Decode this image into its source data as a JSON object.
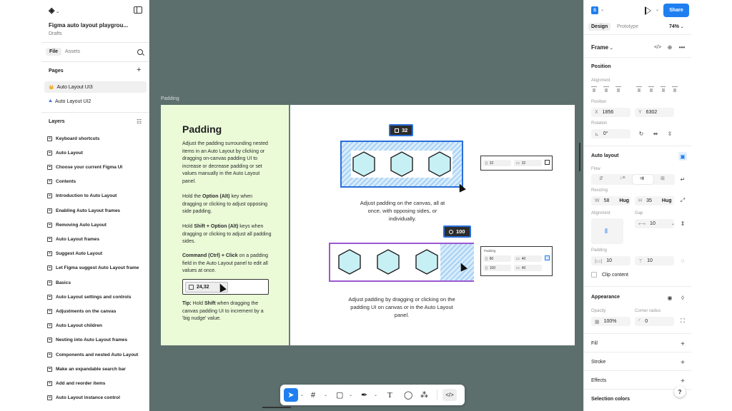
{
  "app": {
    "file_title": "Figma auto layout playgrou...",
    "file_location": "Drafts"
  },
  "left_panel": {
    "tabs": [
      "File",
      "Assets"
    ],
    "pages_title": "Pages",
    "pages": [
      {
        "label": "Auto Layout UI3",
        "icon": "👑"
      },
      {
        "label": "Auto Layout UI2",
        "icon": "⛰"
      }
    ],
    "layers_title": "Layers",
    "layers": [
      "Keyboard shortcuts",
      "Auto Layout",
      "Choose your current Figma UI",
      "Contents",
      "Introduction to Auto Layout",
      "Enabling Auto Layout frames",
      "Removing Auto Layout",
      "Auto Layout frames",
      "Suggest Auto Layout",
      "Let Figma suggest Auto Layout frame",
      "Basics",
      "Auto Layout settings and controls",
      "Adjustments on the canvas",
      "Auto Layout children",
      "Nesting into Auto Layout frames",
      "Components and nested Auto Layout",
      "Make an expandable search bar",
      "Add and  reorder items",
      "Auto Layout instance control"
    ]
  },
  "canvas": {
    "frame_label": "Padding",
    "green": {
      "title": "Padding",
      "p1": "Adjust the padding surrounding nested items in an Auto Layout by clicking or dragging on-canvas padding UI to increase or decrease padding or set values manually in the Auto Layout panel.",
      "p2a": "Hold the ",
      "p2b": "Option (Alt)",
      "p2c": " key when dragging or clicking to adjust opposing side padding.",
      "p3a": "Hold ",
      "p3b": "Shift + Option (Alt)",
      "p3c": " keys when dragging or clicking to adjust all padding sides.",
      "p4a": "Command (Ctrl) + Click",
      "p4b": " on a padding field in the Auto Layout panel to edit all values at once.",
      "input_value": "24,32",
      "tip_a": "Tip:",
      "tip_b": " Hold ",
      "tip_c": "Shift",
      "tip_d": " when dragging the canvas padding UI to increment by a 'big nudge' value."
    },
    "demo1": {
      "pill": "32",
      "caption": "Adjust padding on the canvas, all at once, with opposing sides, or individually.",
      "field_a": "32",
      "field_b": "32"
    },
    "demo2": {
      "pill": "100",
      "caption": "Adjust padding by dragging or clicking on the padding UI on canvas or in the Auto Layout panel.",
      "panel_title": "Padding",
      "f1": "80",
      "f2": "40",
      "f3": "100",
      "f4": "40"
    },
    "toolbar_icons": [
      "move-tool",
      "frame-tool",
      "shape-tool",
      "pen-tool",
      "text-tool",
      "comment-tool",
      "actions-tool",
      "dev-mode-toggle"
    ]
  },
  "right_panel": {
    "avatar": "S",
    "share": "Share",
    "tabs": [
      "Design",
      "Prototype"
    ],
    "zoom": "74%",
    "frame_label": "Frame",
    "position_title": "Position",
    "alignment_label": "Alignment",
    "position_label": "Position",
    "x_label": "X",
    "x_value": "1856",
    "y_label": "Y",
    "y_value": "6302",
    "rotation_label": "Rotation",
    "rotation_value": "0°",
    "auto_layout_title": "Auto layout",
    "flow_label": "Flow",
    "resizing_label": "Resizing",
    "w_label": "W",
    "w_value": "58",
    "w_mode": "Hug",
    "h_label": "H",
    "h_value": "35",
    "h_mode": "Hug",
    "alignment2_label": "Alignment",
    "gap_label": "Gap",
    "gap_value": "10",
    "padding_label": "Padding",
    "pad_h": "10",
    "pad_v": "10",
    "clip_label": "Clip content",
    "appearance_title": "Appearance",
    "opacity_label": "Opacity",
    "opacity_value": "100%",
    "radius_label": "Corner radius",
    "radius_value": "0",
    "fill_title": "Fill",
    "stroke_title": "Stroke",
    "effects_title": "Effects",
    "selection_colors_title": "Selection colors",
    "help": "?"
  }
}
